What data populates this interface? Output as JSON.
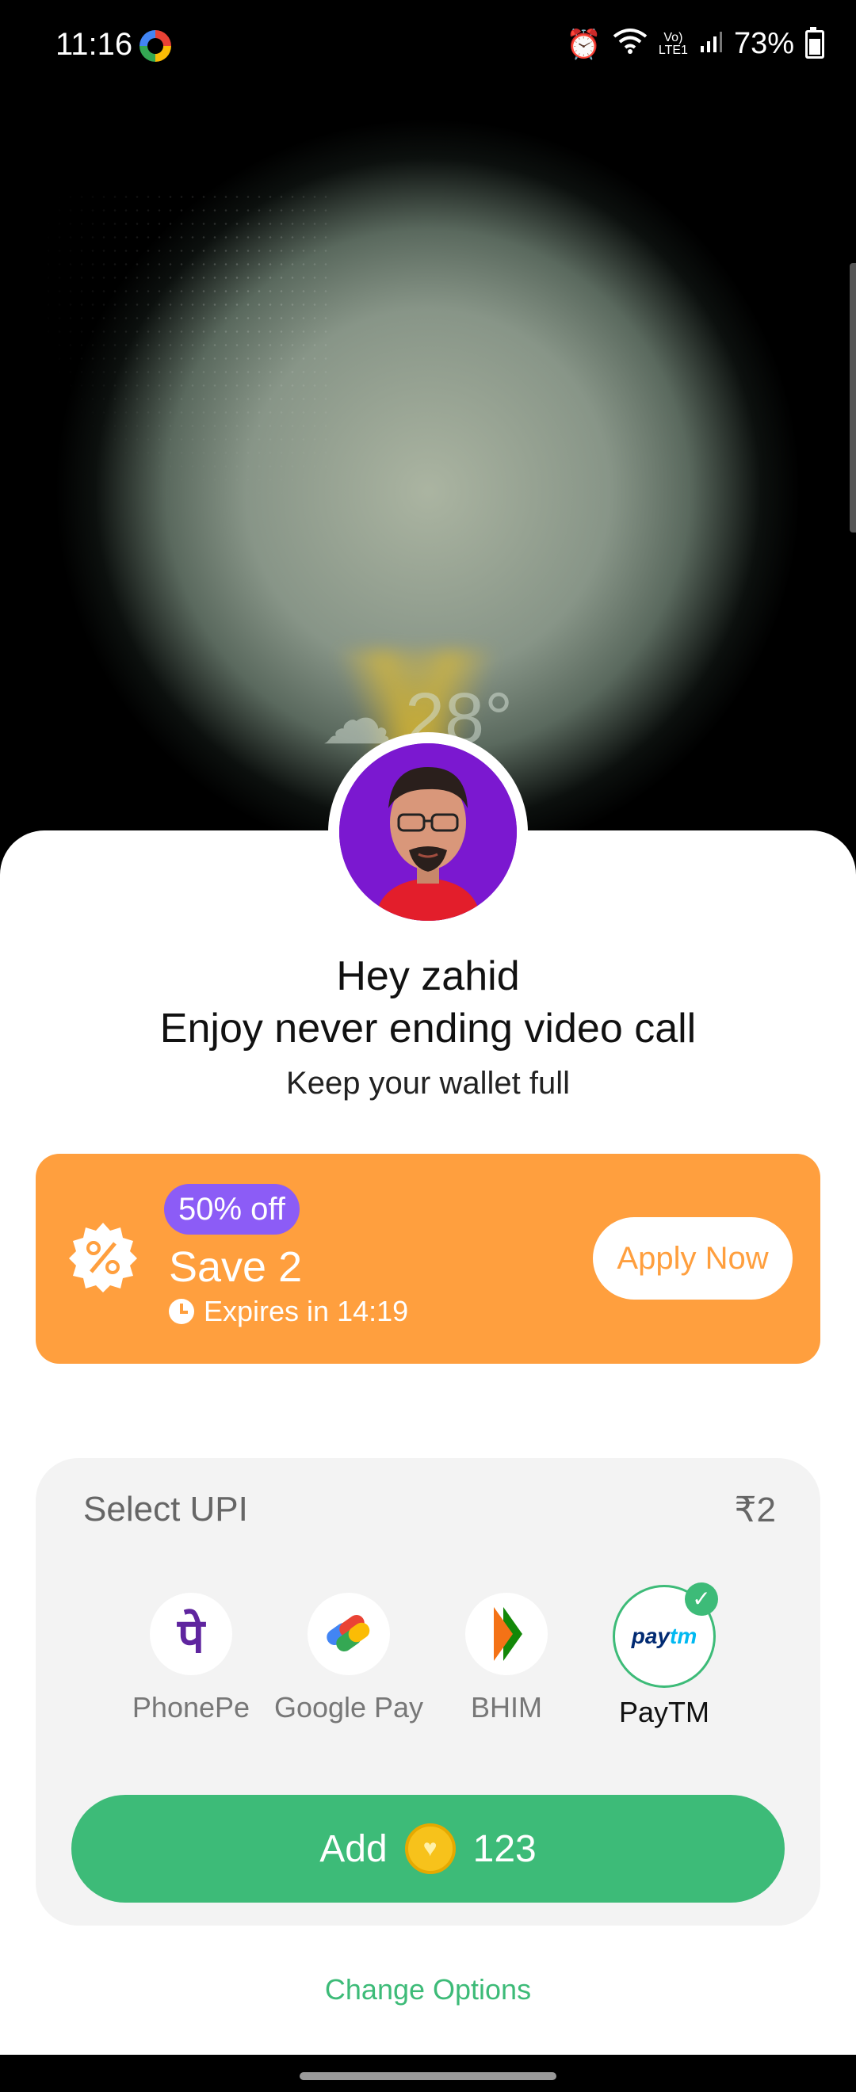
{
  "status_bar": {
    "time": "11:16",
    "battery": "73%"
  },
  "weather": {
    "temperature": "28°",
    "icon": "cloud-fog-icon"
  },
  "greeting": {
    "name_line": "Hey zahid",
    "title": "Enjoy never ending video call",
    "subtitle": "Keep your wallet full"
  },
  "offer": {
    "badge": "50% off",
    "title": "Save 2",
    "expires": "Expires in 14:19",
    "button": "Apply Now",
    "color": "#ff9f3e"
  },
  "upi": {
    "title": "Select UPI",
    "amount": "₹2",
    "options": [
      {
        "label": "PhonePe",
        "icon": "phonepe-icon"
      },
      {
        "label": "Google Pay",
        "icon": "google-pay-icon"
      },
      {
        "label": "BHIM",
        "icon": "bhim-icon"
      },
      {
        "label": "PayTM",
        "icon": "paytm-icon",
        "selected": true
      }
    ],
    "add_label": "Add",
    "add_amount": "123",
    "accent": "#3dbb78"
  },
  "footer": {
    "change_options": "Change Options"
  }
}
